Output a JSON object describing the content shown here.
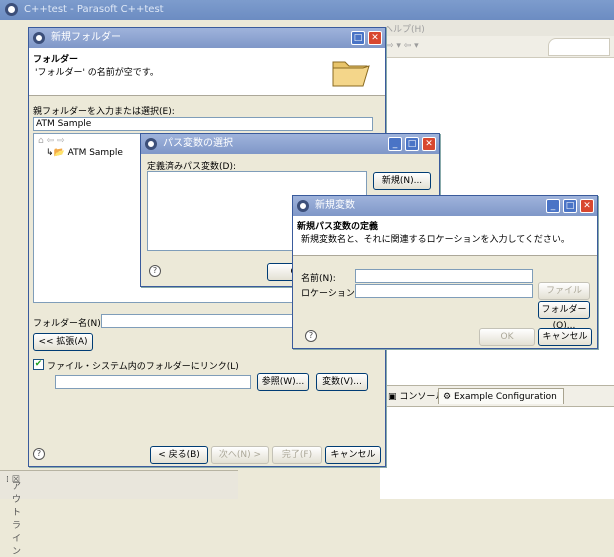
{
  "app": {
    "title": "C++test - Parasoft C++test"
  },
  "bg": {
    "menu_help": "ヘルプ(H)",
    "arrows": "⇨ ▾ ⇦ ▾",
    "console_tab": "コンソール",
    "example_tab": "Example Configuration ...",
    "outline_tab": "アウトライン"
  },
  "new_folder": {
    "title": "新規フォルダー",
    "heading": "フォルダー",
    "message": "'フォルダー' の名前が空です。",
    "parent_label": "親フォルダーを入力または選択(E):",
    "parent_value": "ATM Sample",
    "tree_item": "ATM Sample",
    "folder_name_label": "フォルダー名(N):",
    "folder_name_value": "",
    "advanced_button": "<< 拡張(A)",
    "link_checkbox_label": "ファイル・システム内のフォルダーにリンク(L)",
    "link_value": "",
    "browse_button": "参照(W)...",
    "variables_button": "変数(V)...",
    "back_button": "< 戻る(B)",
    "next_button": "次へ(N) >",
    "finish_button": "完了(F)",
    "cancel_button": "キャンセル"
  },
  "path_var": {
    "title": "パス変数の選択",
    "defined_label": "定義済みパス変数(D):",
    "new_button": "新規(N)...",
    "ok_button": "OK"
  },
  "new_var": {
    "title": "新規変数",
    "heading": "新規パス変数の定義",
    "description": "新規変数名と、それに関連するロケーションを入力してください。",
    "name_label": "名前(N):",
    "name_value": "",
    "location_label": "ロケーション(L):",
    "location_value": "",
    "file_button": "ファイル(E)...",
    "folder_button": "フォルダー(O)...",
    "ok_button": "OK",
    "cancel_button": "キャンセル"
  },
  "help_glyph": "?"
}
